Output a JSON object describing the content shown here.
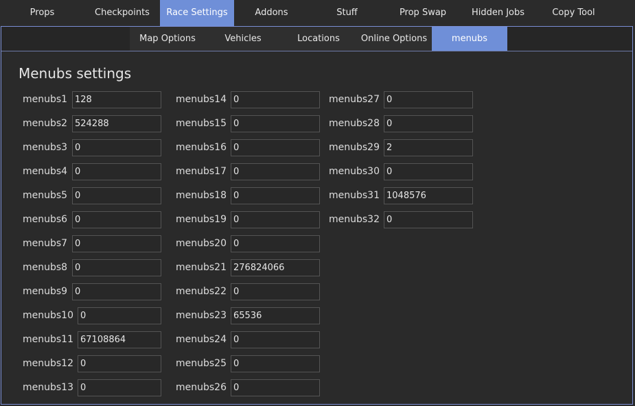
{
  "top_tabs": [
    "Props",
    "Checkpoints",
    "Race Settings",
    "Addons",
    "Stuff",
    "Prop Swap",
    "Hidden Jobs",
    "Copy Tool"
  ],
  "top_active": "Race Settings",
  "sub_tabs": [
    "Map Options",
    "Vehicles",
    "Locations",
    "Online Options",
    "menubs"
  ],
  "sub_active": "menubs",
  "section_title": "Menubs settings",
  "fields": [
    {
      "label": "menubs1",
      "value": "128"
    },
    {
      "label": "menubs2",
      "value": "524288"
    },
    {
      "label": "menubs3",
      "value": "0"
    },
    {
      "label": "menubs4",
      "value": "0"
    },
    {
      "label": "menubs5",
      "value": "0"
    },
    {
      "label": "menubs6",
      "value": "0"
    },
    {
      "label": "menubs7",
      "value": "0"
    },
    {
      "label": "menubs8",
      "value": "0"
    },
    {
      "label": "menubs9",
      "value": "0"
    },
    {
      "label": "menubs10",
      "value": "0"
    },
    {
      "label": "menubs11",
      "value": "67108864"
    },
    {
      "label": "menubs12",
      "value": "0"
    },
    {
      "label": "menubs13",
      "value": "0"
    },
    {
      "label": "menubs14",
      "value": "0"
    },
    {
      "label": "menubs15",
      "value": "0"
    },
    {
      "label": "menubs16",
      "value": "0"
    },
    {
      "label": "menubs17",
      "value": "0"
    },
    {
      "label": "menubs18",
      "value": "0"
    },
    {
      "label": "menubs19",
      "value": "0"
    },
    {
      "label": "menubs20",
      "value": "0"
    },
    {
      "label": "menubs21",
      "value": "276824066"
    },
    {
      "label": "menubs22",
      "value": "0"
    },
    {
      "label": "menubs23",
      "value": "65536"
    },
    {
      "label": "menubs24",
      "value": "0"
    },
    {
      "label": "menubs25",
      "value": "0"
    },
    {
      "label": "menubs26",
      "value": "0"
    },
    {
      "label": "menubs27",
      "value": "0"
    },
    {
      "label": "menubs28",
      "value": "0"
    },
    {
      "label": "menubs29",
      "value": "2"
    },
    {
      "label": "menubs30",
      "value": "0"
    },
    {
      "label": "menubs31",
      "value": "1048576"
    },
    {
      "label": "menubs32",
      "value": "0"
    }
  ],
  "colors": {
    "accent": "#6f8fd8",
    "background": "#2b2b2b",
    "border": "#7b8fd6"
  }
}
